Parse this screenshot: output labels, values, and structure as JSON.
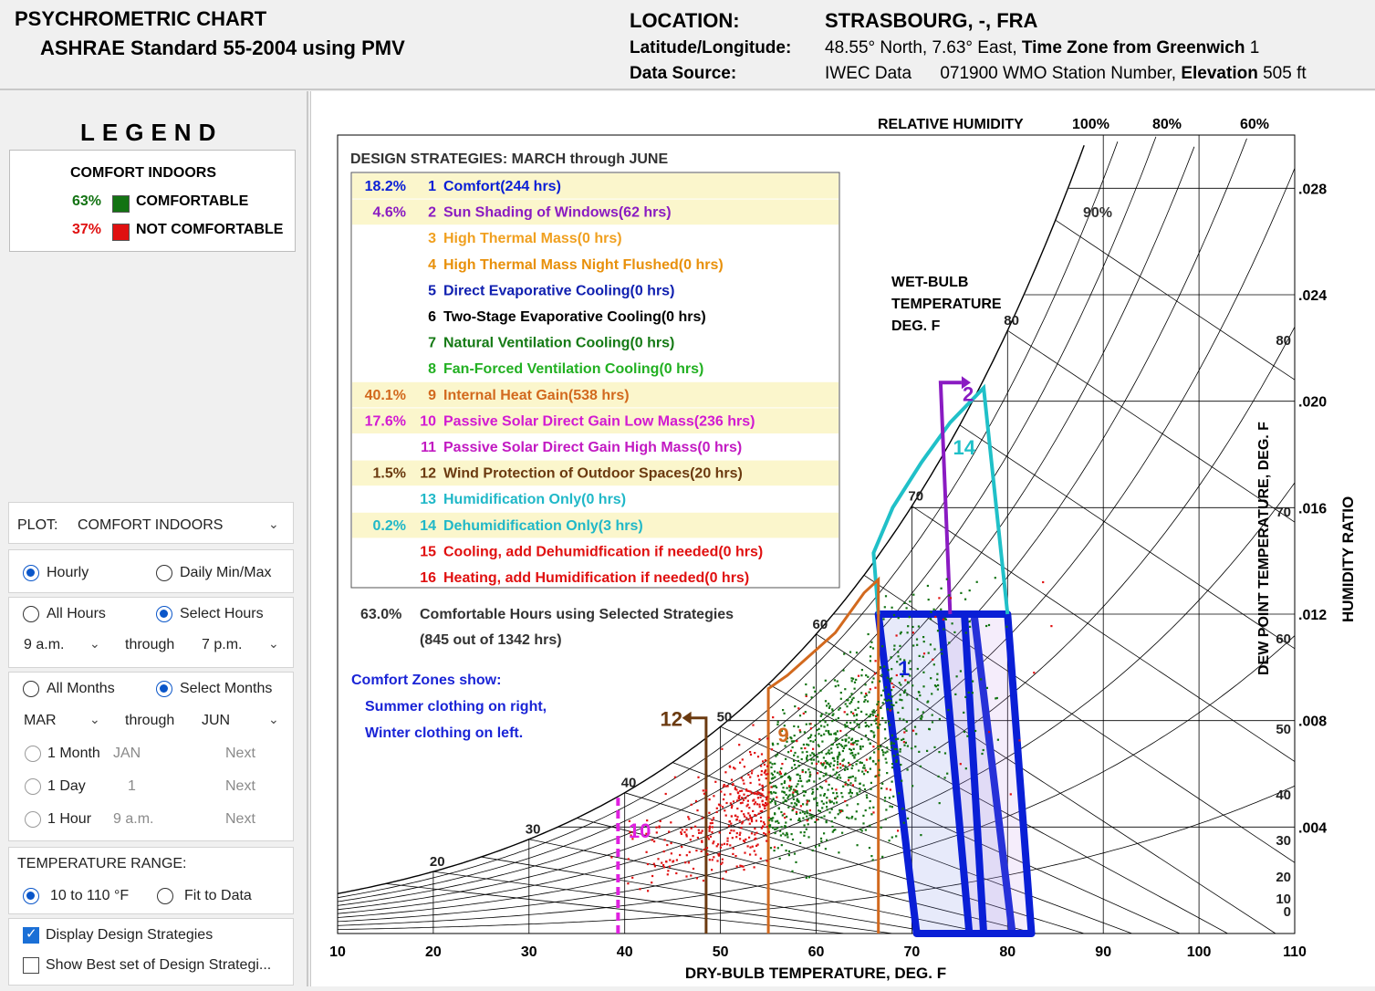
{
  "header": {
    "title": "PSYCHROMETRIC CHART",
    "subtitle": "ASHRAE Standard 55-2004 using PMV",
    "location_label": "LOCATION:",
    "location_value": "STRASBOURG, -, FRA",
    "latlon_label": "Latitude/Longitude:",
    "latlon_value": "48.55° North, 7.63° East,",
    "tz_label": "Time Zone from Greenwich",
    "tz_value": "1",
    "source_label": "Data Source:",
    "source_value": "IWEC Data",
    "station_value": "071900 WMO Station Number,",
    "elev_label": "Elevation",
    "elev_value": "505 ft"
  },
  "legend": {
    "title": "LEGEND",
    "heading": "COMFORT INDOORS",
    "comfortable_pct": "63%",
    "comfortable_label": "COMFORTABLE",
    "comfortable_color": "#137313",
    "not_pct": "37%",
    "not_label": "NOT COMFORTABLE",
    "not_color": "#e01010"
  },
  "controls": {
    "plot_label": "PLOT:",
    "plot_value": "COMFORT INDOORS",
    "hourly": "Hourly",
    "daily": "Daily Min/Max",
    "all_hours": "All Hours",
    "select_hours": "Select Hours",
    "hour_from": "9 a.m.",
    "through": "through",
    "hour_to": "7 p.m.",
    "all_months": "All Months",
    "select_months": "Select Months",
    "month_from": "MAR",
    "month_to": "JUN",
    "one_month": "1 Month",
    "one_month_val": "JAN",
    "one_day": "1 Day",
    "one_day_val": "1",
    "one_hour": "1 Hour",
    "one_hour_val": "9 a.m.",
    "next": "Next",
    "temp_range": "TEMPERATURE RANGE:",
    "range_a": "10 to 110 °F",
    "range_b": "Fit to Data",
    "display_strat": "Display Design Strategies",
    "best_strat": "Show Best set of Design Strategi..."
  },
  "chart_data": {
    "type": "scatter",
    "xlabel": "DRY-BULB TEMPERATURE, DEG. F",
    "ylabel": "HUMIDITY RATIO",
    "ylabel2": "DEW POINT TEMPERATURE, DEG. F",
    "xlim": [
      10,
      110
    ],
    "ylim": [
      0,
      0.03
    ],
    "x_ticks": [
      "10",
      "20",
      "30",
      "40",
      "50",
      "60",
      "70",
      "80",
      "90",
      "100",
      "110"
    ],
    "y_ticks": [
      ".004",
      ".008",
      ".012",
      ".016",
      ".020",
      ".024",
      ".028"
    ],
    "dew_ticks": [
      "0",
      "10",
      "20",
      "30",
      "40",
      "50",
      "60",
      "70",
      "80"
    ],
    "rh_title": "RELATIVE HUMIDITY",
    "rh_labels": [
      "100%",
      "80%",
      "60%",
      "90%"
    ],
    "wb_title": [
      "WET-BULB",
      "TEMPERATURE",
      "DEG. F"
    ],
    "wb_labels": [
      "20",
      "30",
      "40",
      "50",
      "60",
      "70",
      "80"
    ],
    "strategies_title": "DESIGN STRATEGIES:  MARCH through JUNE",
    "strategies": [
      {
        "pct": "18.2%",
        "num": "1",
        "label": "Comfort(244 hrs)",
        "color": "#0a1fd6",
        "hl": true
      },
      {
        "pct": "4.6%",
        "num": "2",
        "label": "Sun Shading of Windows(62 hrs)",
        "color": "#8a1bc2",
        "hl": true
      },
      {
        "pct": "",
        "num": "3",
        "label": "High Thermal Mass(0 hrs)",
        "color": "#f0a020",
        "hl": false
      },
      {
        "pct": "",
        "num": "4",
        "label": "High Thermal Mass Night Flushed(0 hrs)",
        "color": "#e8900a",
        "hl": false
      },
      {
        "pct": "",
        "num": "5",
        "label": "Direct Evaporative Cooling(0 hrs)",
        "color": "#1020b0",
        "hl": false
      },
      {
        "pct": "",
        "num": "6",
        "label": "Two-Stage Evaporative Cooling(0 hrs)",
        "color": "#000000",
        "hl": false
      },
      {
        "pct": "",
        "num": "7",
        "label": "Natural Ventilation Cooling(0 hrs)",
        "color": "#157a15",
        "hl": false
      },
      {
        "pct": "",
        "num": "8",
        "label": "Fan-Forced Ventilation Cooling(0 hrs)",
        "color": "#22b022",
        "hl": false
      },
      {
        "pct": "40.1%",
        "num": "9",
        "label": "Internal Heat Gain(538 hrs)",
        "color": "#d2691e",
        "hl": true
      },
      {
        "pct": "17.6%",
        "num": "10",
        "label": "Passive Solar Direct Gain Low Mass(236 hrs)",
        "color": "#d21ad2",
        "hl": true
      },
      {
        "pct": "",
        "num": "11",
        "label": "Passive Solar Direct Gain High Mass(0 hrs)",
        "color": "#c21ac2",
        "hl": false
      },
      {
        "pct": "1.5%",
        "num": "12",
        "label": "Wind Protection of Outdoor Spaces(20 hrs)",
        "color": "#6b3a10",
        "hl": true
      },
      {
        "pct": "",
        "num": "13",
        "label": "Humidification Only(0 hrs)",
        "color": "#20b8c8",
        "hl": false
      },
      {
        "pct": "0.2%",
        "num": "14",
        "label": "Dehumidification Only(3 hrs)",
        "color": "#20b8c8",
        "hl": true
      },
      {
        "pct": "",
        "num": "15",
        "label": "Cooling, add Dehumidfication if needed(0 hrs)",
        "color": "#e01010",
        "hl": false
      },
      {
        "pct": "",
        "num": "16",
        "label": "Heating, add Humidification if needed(0 hrs)",
        "color": "#e01010",
        "hl": false
      }
    ],
    "summary_pct": "63.0%",
    "summary_text": "Comfortable Hours using Selected Strategies",
    "summary_sub": "(845 out of 1342 hrs)",
    "zones_note": [
      "Comfort Zones show:",
      "Summer clothing on right,",
      "Winter clothing on left."
    ],
    "zone_labels": [
      "1",
      "2",
      "9",
      "10",
      "12",
      "14"
    ],
    "colors": {
      "comfort": "#0a1fd6",
      "shading": "#8a1bc2",
      "heatgain": "#d2691e",
      "solar": "#e020e0",
      "wind": "#6b3a10",
      "dehum": "#20c0c8",
      "green": "#137313",
      "red": "#e01010"
    }
  }
}
